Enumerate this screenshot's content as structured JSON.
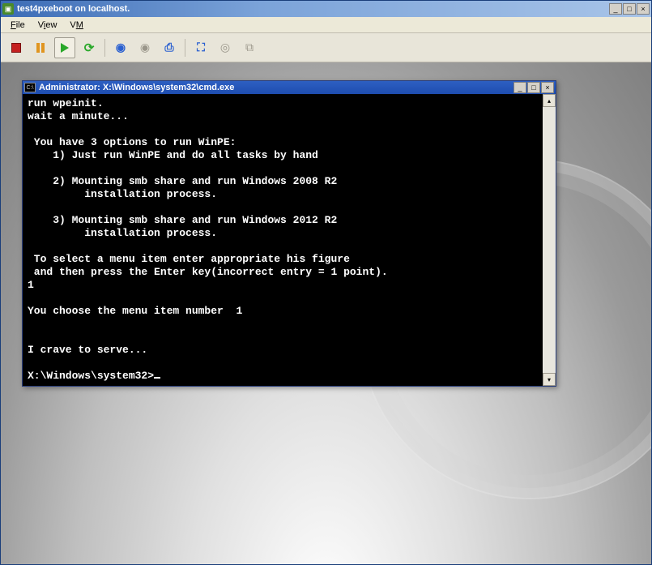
{
  "outer": {
    "title": "test4pxeboot on localhost.",
    "menu": {
      "file": "File",
      "view": "View",
      "vm": "VM"
    }
  },
  "cmd": {
    "icon_label": "C:\\",
    "title": "Administrator: X:\\Windows\\system32\\cmd.exe",
    "lines": [
      "run wpeinit.",
      "wait a minute...",
      "",
      " You have 3 options to run WinPE:",
      "    1) Just run WinPE and do all tasks by hand",
      "",
      "    2) Mounting smb share and run Windows 2008 R2",
      "         installation process.",
      "",
      "    3) Mounting smb share and run Windows 2012 R2",
      "         installation process.",
      "",
      " To select a menu item enter appropriate his figure",
      " and then press the Enter key(incorrect entry = 1 point).",
      "1",
      "",
      "You choose the menu item number  1",
      "",
      "",
      "I crave to serve...",
      "",
      "X:\\Windows\\system32>"
    ]
  }
}
